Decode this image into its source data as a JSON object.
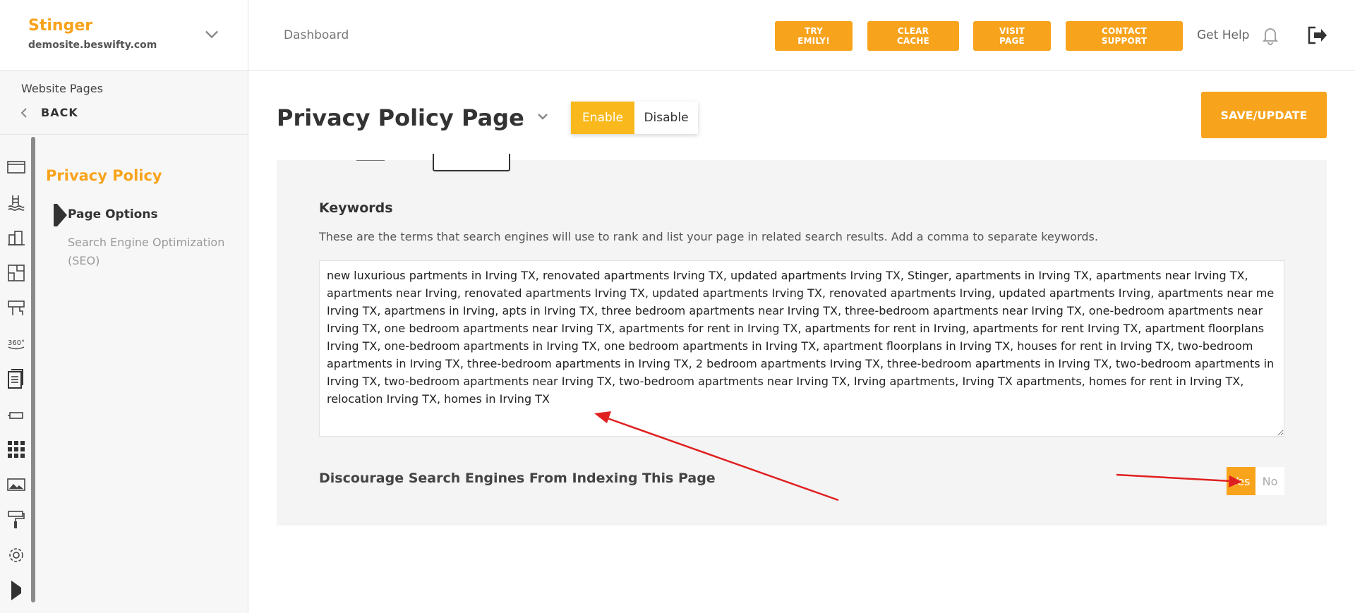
{
  "brand": {
    "name": "Stinger",
    "domain": "demosite.beswifty.com"
  },
  "sidebar": {
    "section_label": "Website Pages",
    "back_label": "BACK",
    "page_title": "Privacy Policy",
    "items": [
      {
        "label": "Page Options",
        "active": true
      },
      {
        "label": "Search Engine Optimization (SEO)",
        "active": false
      }
    ],
    "rail_icons": [
      "browser-window-icon",
      "pool-icon",
      "buildings-icon",
      "floorplan-icon",
      "amenities-icon",
      "360-view-icon",
      "pages-icon",
      "tools-icon",
      "apps-grid-icon",
      "gallery-icon",
      "paint-roller-icon",
      "settings-icon",
      "expand-icon"
    ]
  },
  "header": {
    "breadcrumb": "Dashboard",
    "buttons": [
      "TRY EMILY!",
      "CLEAR CACHE",
      "VISIT PAGE",
      "CONTACT SUPPORT"
    ],
    "get_help": "Get Help"
  },
  "page": {
    "title": "Privacy Policy Page",
    "enable_label": "Enable",
    "disable_label": "Disable",
    "save_label": "SAVE/UPDATE"
  },
  "seo": {
    "keywords_label": "Keywords",
    "keywords_help": "These are the terms that search engines will use to rank and list your page in related search results. Add a comma to separate keywords.",
    "keywords_value": "new luxurious partments in Irving TX, renovated apartments Irving TX, updated apartments Irving TX, Stinger, apartments in Irving TX, apartments near Irving TX, apartments near Irving, renovated apartments Irving TX, updated apartments Irving TX, renovated apartments Irving, updated apartments Irving, apartments near me Irving TX, apartmens in Irving, apts in Irving TX, three bedroom apartments near Irving TX, three-bedroom apartments near Irving TX, one-bedroom apartments near Irving TX, one bedroom apartments near Irving TX, apartments for rent in Irving TX, apartments for rent in Irving, apartments for rent Irving TX, apartment floorplans Irving TX, one-bedroom apartments in Irving TX, one bedroom apartments in Irving TX, apartment floorplans in Irving TX, houses for rent in Irving TX, two-bedroom apartments in Irving TX, three-bedroom apartments in Irving TX, 2 bedroom apartments Irving TX, three-bedroom apartments in Irving TX, two-bedroom apartments in Irving TX, two-bedroom apartments near Irving TX, two-bedroom apartments near Irving TX, Irving apartments, Irving TX apartments, homes for rent in Irving TX, relocation Irving TX, homes in Irving TX",
    "discourage_label": "Discourage Search Engines From Indexing This Page",
    "yes_label": "Yes",
    "no_label": "No"
  },
  "colors": {
    "accent": "#f8a31c",
    "enable": "#f9b81b",
    "panel": "#f4f4f4",
    "annotation": "#e02020"
  }
}
